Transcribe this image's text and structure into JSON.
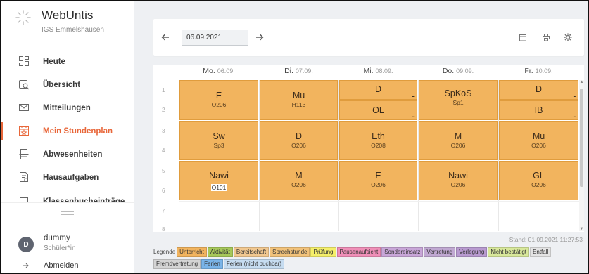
{
  "app": {
    "title": "WebUntis",
    "school": "IGS Emmelshausen"
  },
  "nav": [
    {
      "label": "Heute",
      "icon": "dashboard-icon",
      "active": false
    },
    {
      "label": "Übersicht",
      "icon": "search-overview-icon",
      "active": false
    },
    {
      "label": "Mitteilungen",
      "icon": "mail-icon",
      "active": false
    },
    {
      "label": "Mein Stundenplan",
      "icon": "calendar-icon",
      "active": true
    },
    {
      "label": "Abwesenheiten",
      "icon": "absence-icon",
      "active": false
    },
    {
      "label": "Hausaufgaben",
      "icon": "homework-icon",
      "active": false
    },
    {
      "label": "Klassenbucheinträge",
      "icon": "classbook-icon",
      "active": false
    }
  ],
  "user": {
    "initial": "D",
    "name": "dummy",
    "role": "Schüler*in",
    "logout_label": "Abmelden"
  },
  "toolbar": {
    "date": "06.09.2021"
  },
  "days": [
    {
      "name": "Mo.",
      "date": "06.09."
    },
    {
      "name": "Di.",
      "date": "07.09."
    },
    {
      "name": "Mi.",
      "date": "08.09."
    },
    {
      "name": "Do.",
      "date": "09.09."
    },
    {
      "name": "Fr.",
      "date": "10.09."
    }
  ],
  "hours": [
    "1",
    "2",
    "3",
    "4",
    "5",
    "6",
    "7",
    "8"
  ],
  "lessons": {
    "mo1": {
      "subject": "E",
      "room": "O206"
    },
    "di1": {
      "subject": "Mu",
      "room": "H113"
    },
    "mi1a": {
      "subject": "D",
      "more": "..."
    },
    "mi1b": {
      "subject": "OL",
      "more": "..."
    },
    "do1": {
      "subject": "SpKoS",
      "room": "Sp1"
    },
    "fr1a": {
      "subject": "D",
      "more": "..."
    },
    "fr1b": {
      "subject": "IB",
      "more": "..."
    },
    "mo3": {
      "subject": "Sw",
      "room": "Sp3"
    },
    "di3": {
      "subject": "D",
      "room": "O206"
    },
    "mi3": {
      "subject": "Eth",
      "room": "O208"
    },
    "do3": {
      "subject": "M",
      "room": "O206"
    },
    "fr3": {
      "subject": "Mu",
      "room": "O206"
    },
    "mo5": {
      "subject": "Nawi",
      "room": "O101"
    },
    "di5": {
      "subject": "M",
      "room": "O206"
    },
    "mi5": {
      "subject": "E",
      "room": "O206"
    },
    "do5": {
      "subject": "Nawi",
      "room": "O206"
    },
    "fr5": {
      "subject": "GL",
      "room": "O206"
    }
  },
  "stand": "Stand: 01.09.2021 11:27:53",
  "legend": {
    "title": "Legende",
    "items": [
      {
        "label": "Unterricht",
        "color": "#f2b45e"
      },
      {
        "label": "Aktivität",
        "color": "#a6c85a"
      },
      {
        "label": "Bereitschaft",
        "color": "#f2c890"
      },
      {
        "label": "Sprechstunde",
        "color": "#f2c27a"
      },
      {
        "label": "Prüfung",
        "color": "#f5ef6a"
      },
      {
        "label": "Pausenaufsicht",
        "color": "#f08fb8"
      },
      {
        "label": "Sondereinsatz",
        "color": "#c8a6d8"
      },
      {
        "label": "Vertretung",
        "color": "#c0a8d2"
      },
      {
        "label": "Verlegung",
        "color": "#b89ad0"
      },
      {
        "label": "Nicht bestätigt",
        "color": "#d8e89a"
      },
      {
        "label": "Entfall",
        "color": "#e4e4e4"
      },
      {
        "label": "Fremdvertretung",
        "color": "#d4d4d4"
      },
      {
        "label": "Ferien",
        "color": "#7ab4e8"
      },
      {
        "label": "Ferien (nicht buchbar)",
        "color": "#c6dcf0"
      }
    ]
  },
  "colors": {
    "accent": "#e8673a",
    "lesson": "#f2b45e"
  }
}
